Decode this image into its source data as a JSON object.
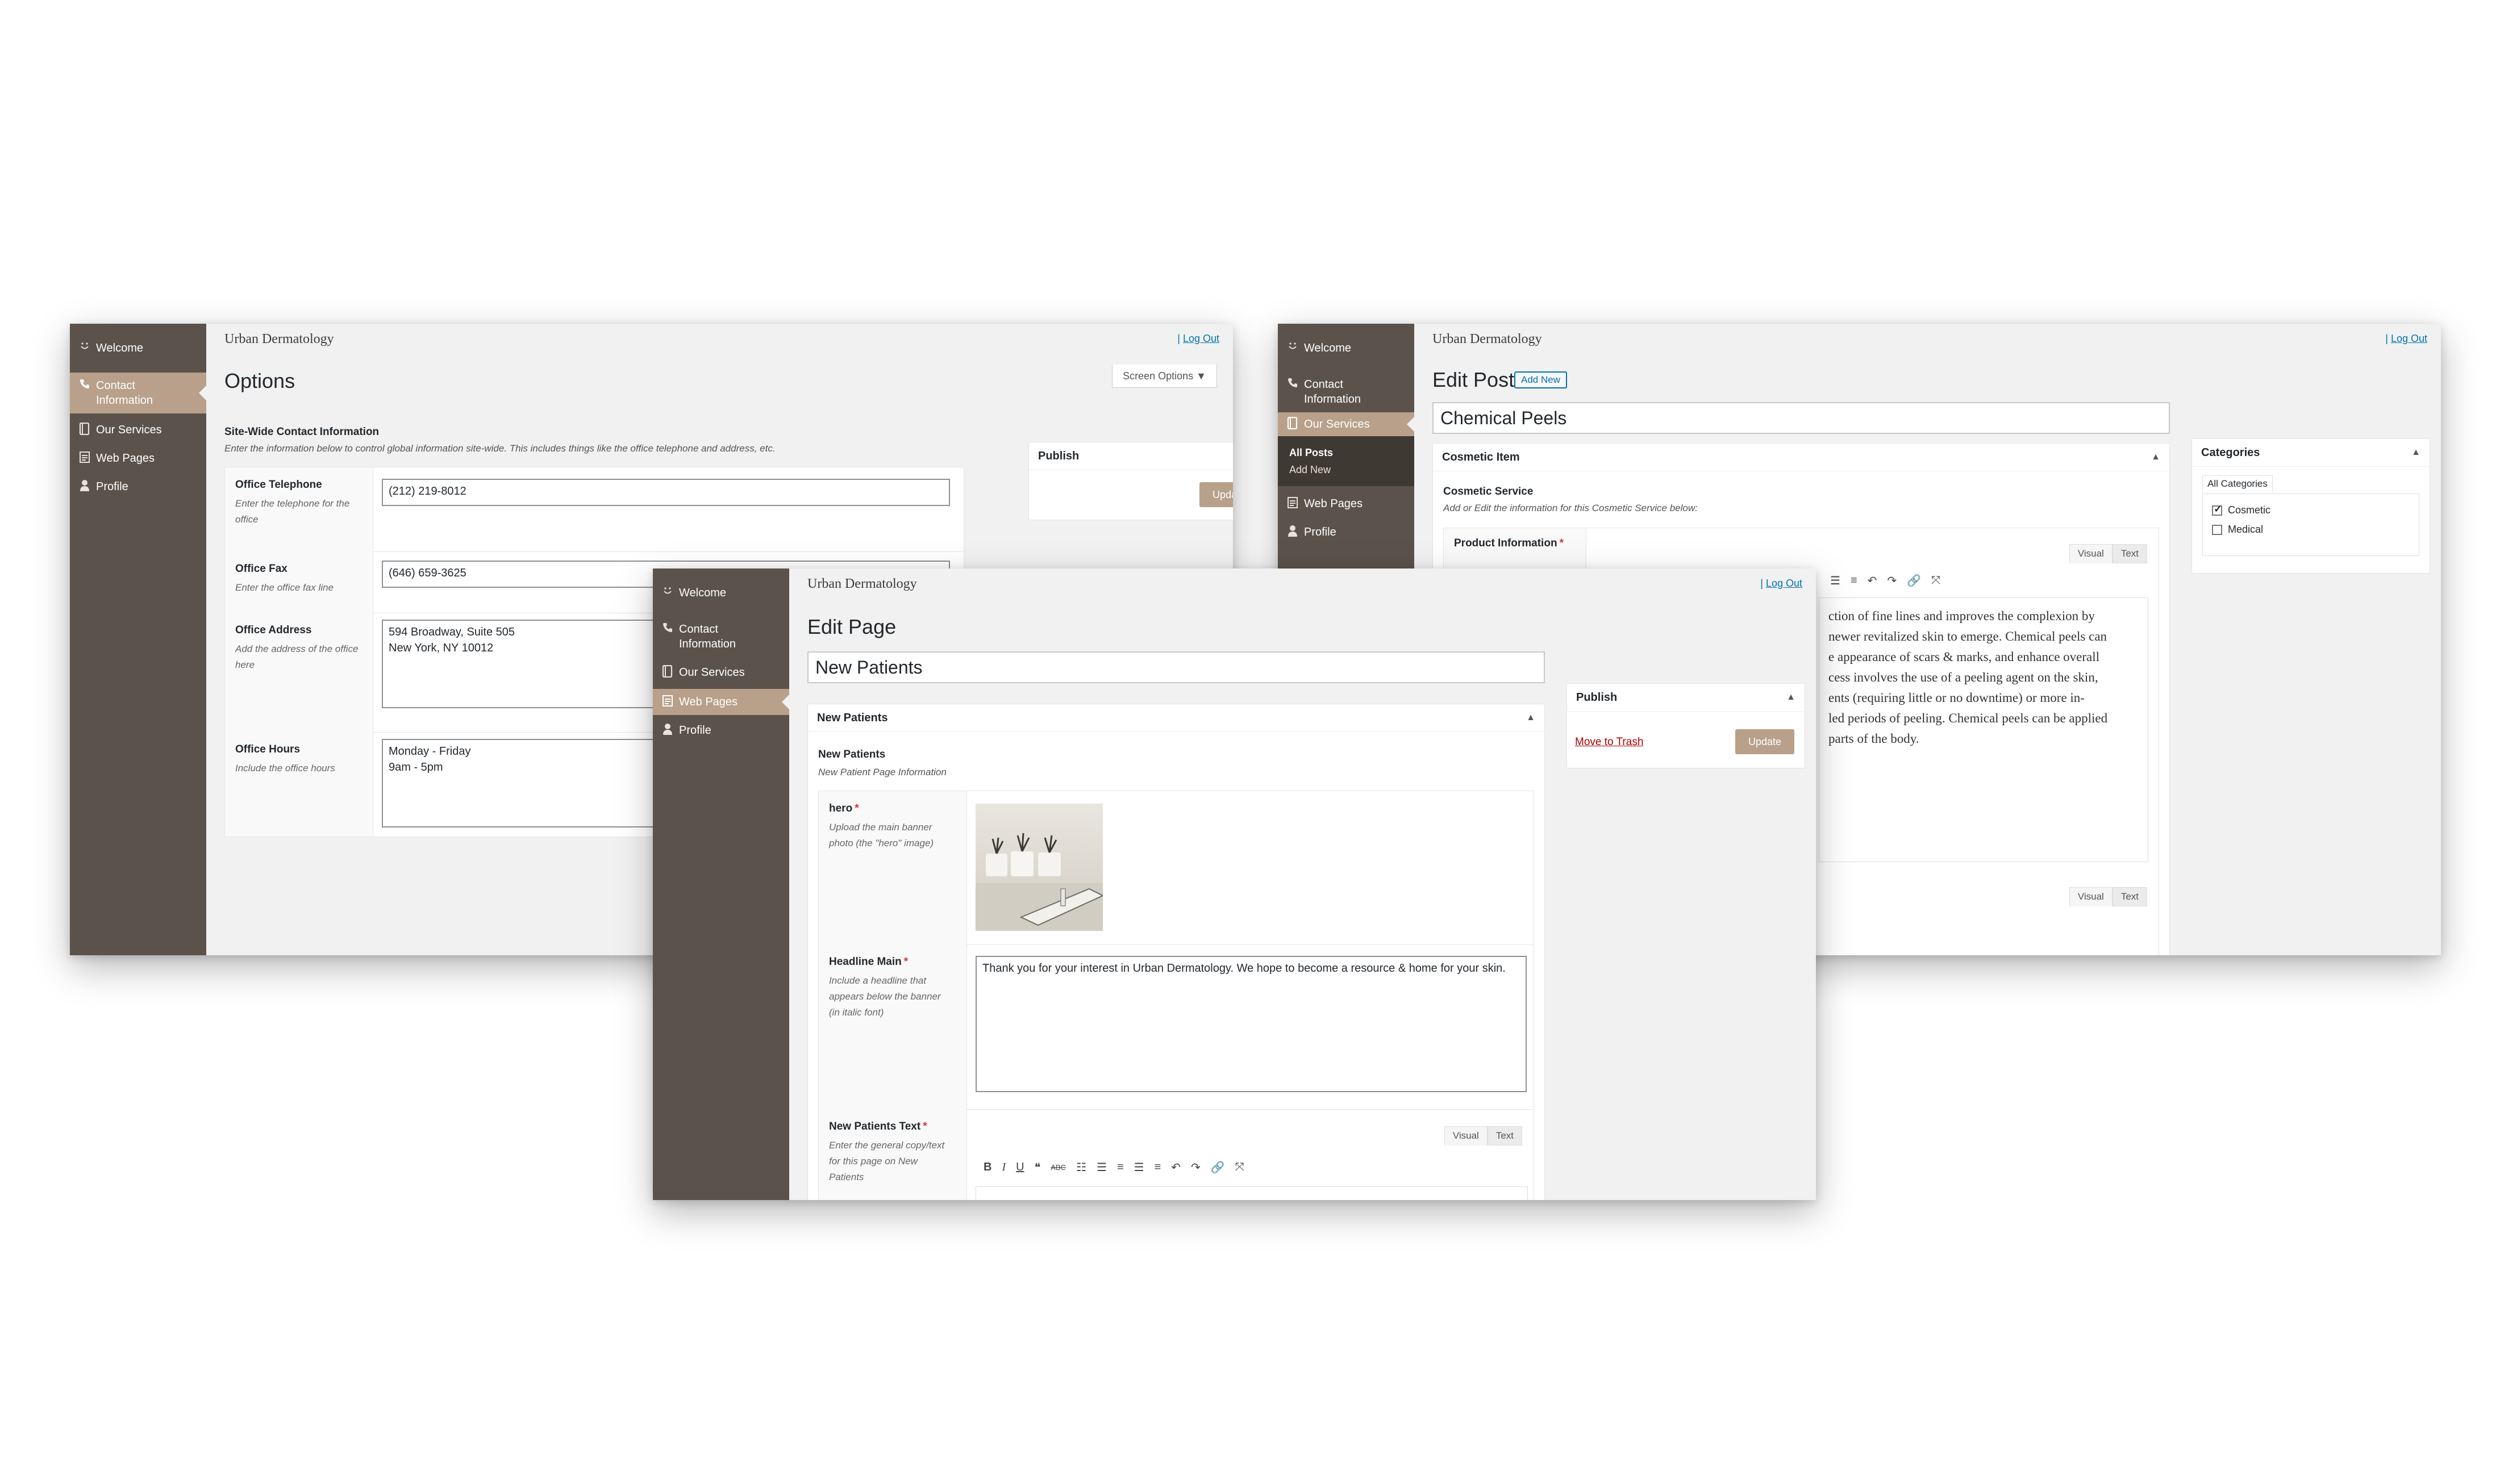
{
  "site_name": "Urban Dermatology",
  "logout": "Log Out",
  "logout_sep": "|",
  "menu": {
    "welcome": "Welcome",
    "contact": "Contact Information",
    "services": "Our Services",
    "web_pages": "Web Pages",
    "profile": "Profile",
    "all_posts": "All Posts",
    "add_new": "Add New"
  },
  "options_window": {
    "page_title": "Options",
    "screen_options": "Screen Options",
    "section_title": "Site-Wide Contact Information",
    "section_desc": "Enter the information below to control global information site-wide. This includes things like the office telephone and address, etc.",
    "publish_title": "Publish",
    "update_label": "Update",
    "fields": {
      "telephone": {
        "label": "Office Telephone",
        "desc": "Enter the telephone for the office",
        "value": "(212) 219-8012"
      },
      "fax": {
        "label": "Office Fax",
        "desc": "Enter the office fax line",
        "value": "(646) 659-3625"
      },
      "address": {
        "label": "Office Address",
        "desc": "Add the address of the office here",
        "value": "594 Broadway, Suite 505\nNew York, NY 10012"
      },
      "hours": {
        "label": "Office Hours",
        "desc": "Include the office hours",
        "value": "Monday - Friday\n9am - 5pm"
      }
    }
  },
  "post_window": {
    "page_title": "Edit Post",
    "add_new_label": "Add New",
    "post_title": "Chemical Peels",
    "box_title": "Cosmetic Item",
    "section_title": "Cosmetic Service",
    "section_desc": "Add or Edit the information for this Cosmetic Service below:",
    "field_label": "Product Information",
    "tab_visual": "Visual",
    "tab_text": "Text",
    "body_lines": [
      "ction of fine lines and improves the complexion by",
      "newer revitalized skin to emerge. Chemical peels can",
      "e appearance of scars & marks, and enhance overall",
      "cess involves the use of a peeling agent on the skin,",
      "ents (requiring little or no downtime) or more in-",
      "led periods of peeling. Chemical peels can be applied",
      "parts of the body."
    ],
    "categories_title": "Categories",
    "categories_tab": "All Categories",
    "categories": [
      {
        "name": "Cosmetic",
        "checked": true
      },
      {
        "name": "Medical",
        "checked": false
      }
    ]
  },
  "page_window": {
    "page_title": "Edit Page",
    "post_title": "New Patients",
    "box_title": "New Patients",
    "section_title": "New Patients",
    "section_desc": "New Patient Page Information",
    "publish_title": "Publish",
    "trash_label": "Move to Trash",
    "update_label": "Update",
    "fields": {
      "hero": {
        "label": "hero",
        "desc": "Upload the main banner photo (the \"hero\" image)"
      },
      "headline": {
        "label": "Headline Main",
        "desc": "Include a headline that appears below the banner (in italic font)",
        "value": "Thank you for your interest in Urban Dermatology. We hope to become a resource & home for your skin."
      },
      "text": {
        "label": "New Patients Text",
        "desc": "Enter the general copy/text for this page on New Patients"
      }
    },
    "tab_visual": "Visual",
    "tab_text": "Text"
  },
  "required_mark": "*",
  "colors": {
    "sidebar": "#5b534b",
    "accent": "#b8a08a",
    "link": "#0073aa"
  }
}
